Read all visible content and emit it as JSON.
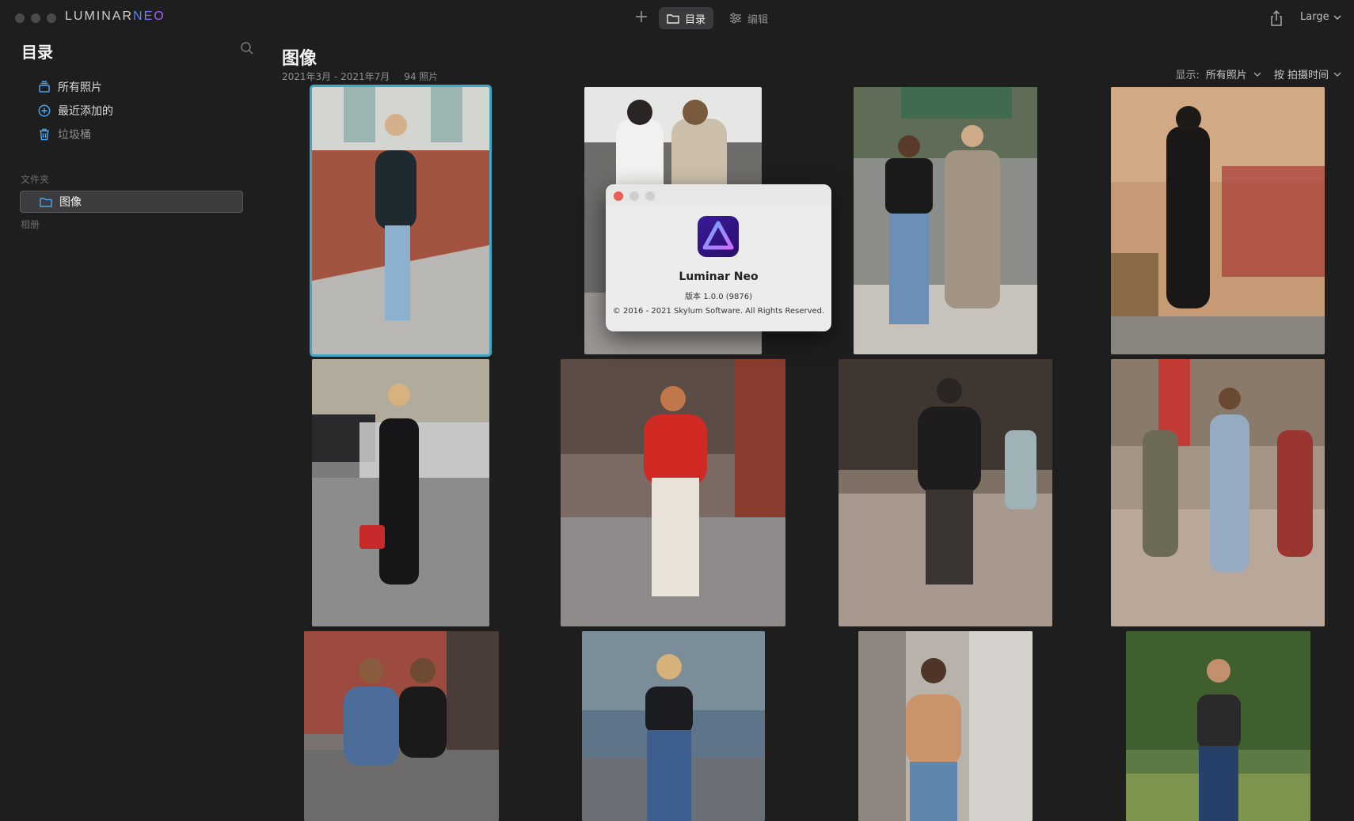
{
  "app": {
    "brand_prefix": "LUMINAR",
    "brand_suffix": "NEO"
  },
  "toolbar": {
    "add_icon": "plus-icon",
    "catalog_tab": "目录",
    "edit_tab": "编辑",
    "share_icon": "share-icon",
    "size_label": "Large"
  },
  "sidebar": {
    "title": "目录",
    "items": [
      {
        "label": "所有照片",
        "icon": "photos-stack-icon"
      },
      {
        "label": "最近添加的",
        "icon": "plus-circle-icon"
      },
      {
        "label": "垃圾桶",
        "icon": "trash-icon"
      }
    ],
    "folders_section": "文件夹",
    "folders": [
      {
        "label": "图像",
        "icon": "folder-icon"
      }
    ],
    "albums_section": "相册"
  },
  "main": {
    "title": "图像",
    "date_range": "2021年3月 - 2021年7月",
    "count": "94 照片",
    "filter_label": "显示:",
    "filter_value": "所有照片",
    "sort_label": "按 拍摄时间"
  },
  "dialog": {
    "app_name": "Luminar Neo",
    "version": "版本 1.0.0 (9876)",
    "copyright": "© 2016 - 2021 Skylum Software. All Rights Reserved."
  },
  "colors": {
    "background": "#1e1e1f",
    "selection": "#3ea9c6",
    "accent_blue": "#4aa3f0"
  },
  "photos": [
    {
      "name": "woman-blazer-brick-wall",
      "selected": true
    },
    {
      "name": "two-women-sunglasses-street",
      "selected": false
    },
    {
      "name": "two-women-crosswalk",
      "selected": false
    },
    {
      "name": "woman-black-coat-hat",
      "selected": false
    },
    {
      "name": "woman-offshoulder-red-bag",
      "selected": false
    },
    {
      "name": "woman-red-sweater",
      "selected": false
    },
    {
      "name": "woman-black-hoodie-plaid",
      "selected": false
    },
    {
      "name": "group-walking-street",
      "selected": false
    },
    {
      "name": "two-women-denim",
      "selected": false
    },
    {
      "name": "woman-crop-top-jeans",
      "selected": false
    },
    {
      "name": "woman-tan-sweater",
      "selected": false
    },
    {
      "name": "woman-striped-top-park",
      "selected": false
    }
  ]
}
